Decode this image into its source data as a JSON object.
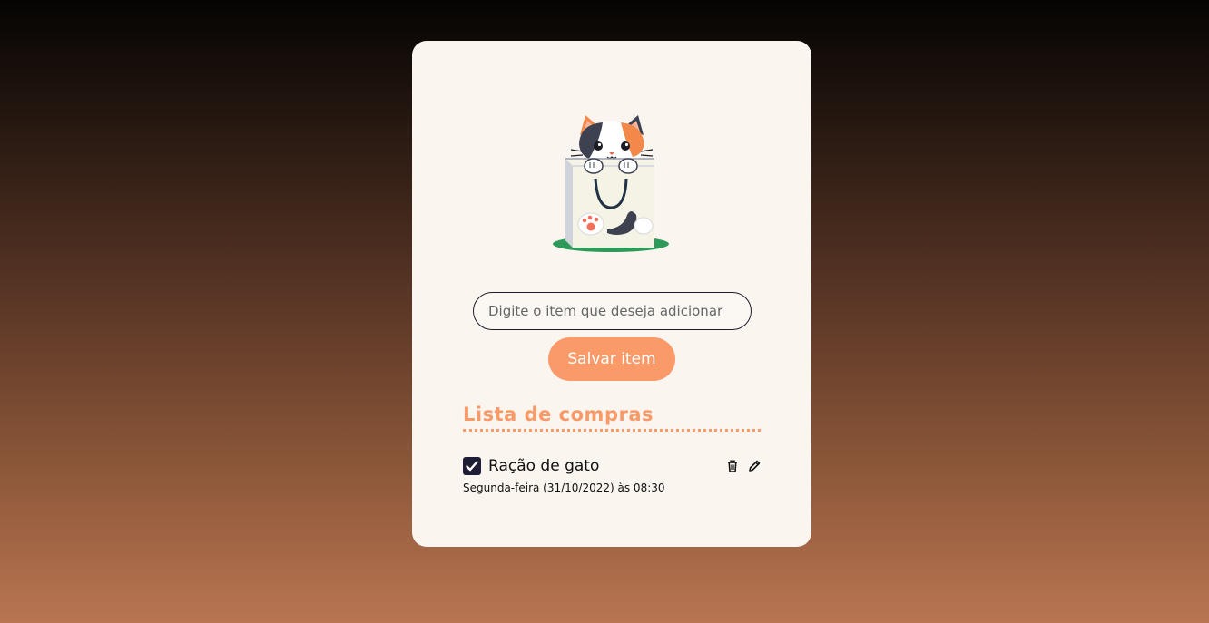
{
  "form": {
    "input_placeholder": "Digite o item que deseja adicionar",
    "input_value": "",
    "save_label": "Salvar item"
  },
  "list": {
    "title": "Lista de compras",
    "items": [
      {
        "name": "Ração de gato",
        "checked": true,
        "date": "Segunda-feira (31/10/2022) às 08:30",
        "icons": [
          "trash-icon",
          "pencil-icon"
        ]
      }
    ]
  },
  "colors": {
    "accent": "#f99a68",
    "dark": "#1d1d35",
    "card_bg": "#faf5ef"
  },
  "illustration": "cat-in-shopping-bag"
}
